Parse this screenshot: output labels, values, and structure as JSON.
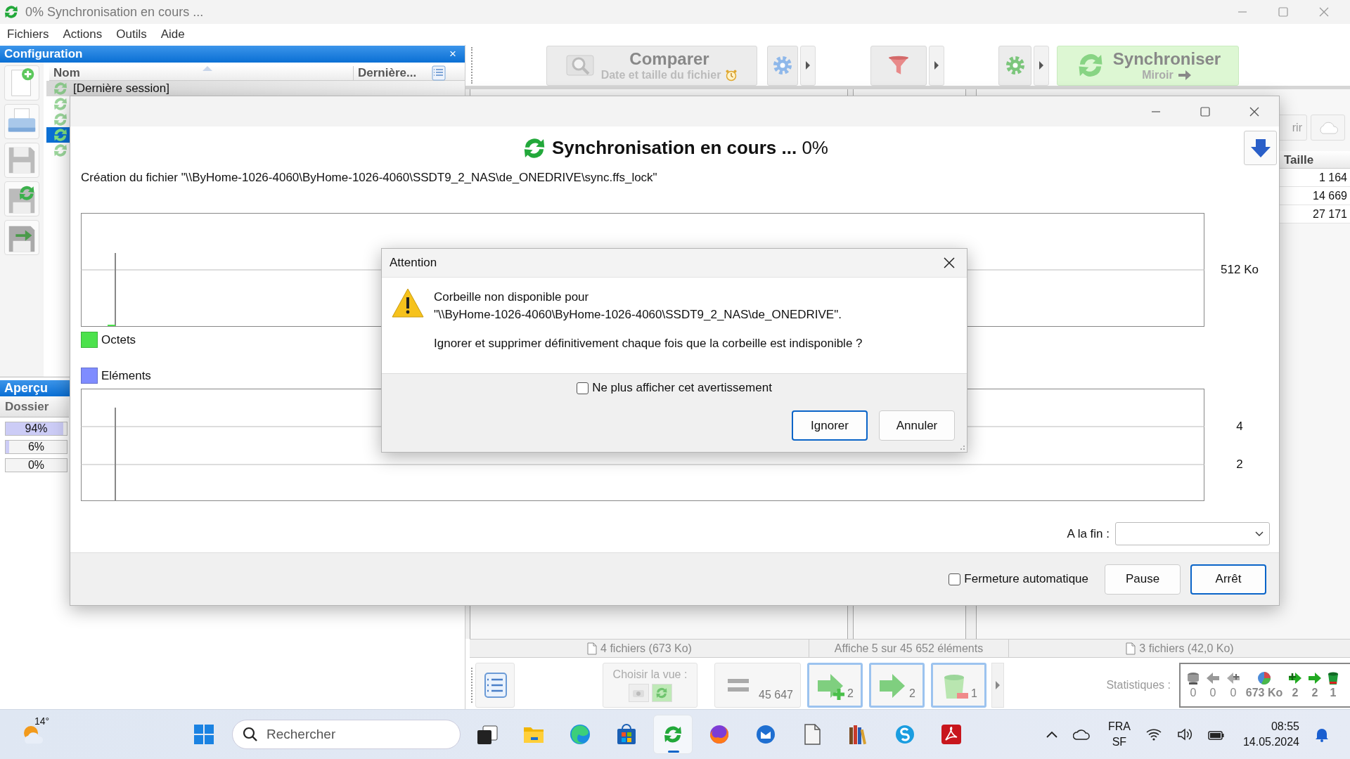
{
  "window": {
    "title": "0% Synchronisation en cours ..."
  },
  "menu": [
    "Fichiers",
    "Actions",
    "Outils",
    "Aide"
  ],
  "configuration_panel": {
    "title": "Configuration",
    "close": "×",
    "columns": [
      "Nom",
      "Dernière..."
    ],
    "items": [
      {
        "kind": "last_session",
        "label": "[Dernière session]",
        "selected": false
      },
      {
        "kind": "config",
        "selected": false
      },
      {
        "kind": "config",
        "selected": false
      },
      {
        "kind": "config",
        "selected": true
      },
      {
        "kind": "config",
        "selected": false
      }
    ]
  },
  "preview_panel": {
    "title": "Aperçu",
    "column": "Dossier",
    "bars": [
      {
        "label": "94%",
        "level": 0.94
      },
      {
        "label": "6%",
        "level": 0.06
      },
      {
        "label": "0%",
        "level": 0
      }
    ]
  },
  "toolbar": {
    "compare": {
      "label": "Comparer",
      "sublabel": "Date et taille du fichier"
    },
    "synchronize": {
      "label": "Synchroniser",
      "sublabel": "Miroir"
    }
  },
  "right_grid": {
    "button": "rir",
    "column": "Taille",
    "rows": [
      "1 164",
      "14 669",
      "27 171"
    ]
  },
  "status_bar": [
    "4 fichiers (673 Ko)",
    "Affiche 5 sur 45 652 éléments",
    "3 fichiers (42,0 Ko)"
  ],
  "view_bar": {
    "view_label": "Choisir la vue :",
    "filters": [
      {
        "kind": "equal",
        "count": "45 647",
        "on": false
      },
      {
        "kind": "create",
        "count": "2",
        "on": true
      },
      {
        "kind": "update",
        "count": "2",
        "on": true
      },
      {
        "kind": "delete",
        "count": "1",
        "on": true
      }
    ],
    "statistics_label": "Statistiques :",
    "statistics": [
      "0",
      "0",
      "0",
      "673 Ko",
      "2",
      "2",
      "1"
    ]
  },
  "progress_window": {
    "heading": "**Synchronisation en cours ...** 0%",
    "status": "Création du fichier \"\\\\ByHome-1026-4060\\ByHome-1026-4060\\SSDT9_2_NAS\\de_ONEDRIVE\\sync.ffs_lock\"",
    "bytes_axis": "512 Ko",
    "legend": [
      {
        "label": "Octets",
        "color": "#4ce24c"
      },
      {
        "label": "Eléments",
        "color": "#7f8cff"
      }
    ],
    "items_axis": [
      "4",
      "2"
    ],
    "on_finish_label": "A la fin :",
    "auto_close": {
      "label": "Fermeture automatique",
      "checked": false
    },
    "buttons": [
      {
        "label": "Pause",
        "default": false
      },
      {
        "label": "Arrêt",
        "default": true
      }
    ]
  },
  "dialog": {
    "title": "Attention",
    "message": "Corbeille non disponible pour\n\"\\\\ByHome-1026-4060\\ByHome-1026-4060\\SSDT9_2_NAS\\de_ONEDRIVE\".",
    "question": "Ignorer et supprimer définitivement chaque fois que la corbeille est indisponible ?",
    "dont_show": {
      "label": "Ne plus afficher cet avertissement",
      "checked": false
    },
    "buttons": [
      {
        "label": "Ignorer",
        "default": true
      },
      {
        "label": "Annuler",
        "default": false
      }
    ]
  },
  "taskbar": {
    "temperature": "14°",
    "search_placeholder": "Rechercher",
    "apps": [
      {
        "selected": false
      },
      {
        "selected": false
      },
      {
        "selected": false
      },
      {
        "selected": false
      },
      {
        "selected": true
      },
      {
        "selected": false
      },
      {
        "selected": false
      },
      {
        "selected": false
      },
      {
        "selected": false
      },
      {
        "selected": false
      },
      {
        "selected": false
      }
    ],
    "language": "FRA",
    "layout": "SF",
    "time": "08:55",
    "date": "14.05.2024"
  }
}
